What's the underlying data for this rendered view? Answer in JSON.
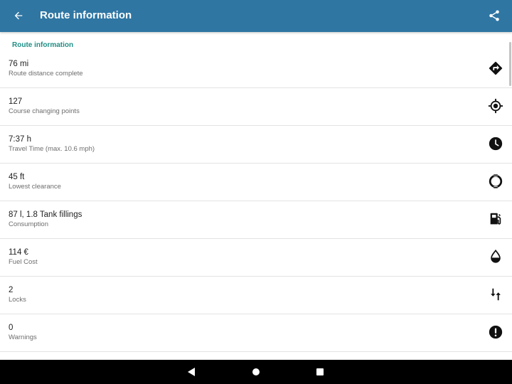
{
  "appbar": {
    "title": "Route information",
    "back_icon": "arrow-back-icon",
    "share_icon": "share-icon",
    "color": "#2f76a3"
  },
  "section": {
    "header": "Route information",
    "color": "#1f8f86"
  },
  "rows": [
    {
      "value": "76 mi",
      "label": "Route distance complete",
      "icon": "turn-right-diamond-icon"
    },
    {
      "value": "127",
      "label": "Course changing points",
      "icon": "crosshair-target-icon"
    },
    {
      "value": "7:37 h",
      "label": "Travel Time (max. 10.6 mph)",
      "icon": "clock-icon"
    },
    {
      "value": "45 ft",
      "label": "Lowest clearance",
      "icon": "clearance-circle-icon"
    },
    {
      "value": "87 l, 1.8 Tank fillings",
      "label": "Consumption",
      "icon": "fuel-pump-icon"
    },
    {
      "value": "114 €",
      "label": "Fuel Cost",
      "icon": "fuel-drop-icon"
    },
    {
      "value": "2",
      "label": "Locks",
      "icon": "lock-arrows-icon"
    },
    {
      "value": "0",
      "label": "Warnings",
      "icon": "warning-icon"
    }
  ],
  "navbar": {
    "back_icon": "nav-back-triangle-icon",
    "home_icon": "nav-home-circle-icon",
    "recents_icon": "nav-recents-square-icon"
  }
}
